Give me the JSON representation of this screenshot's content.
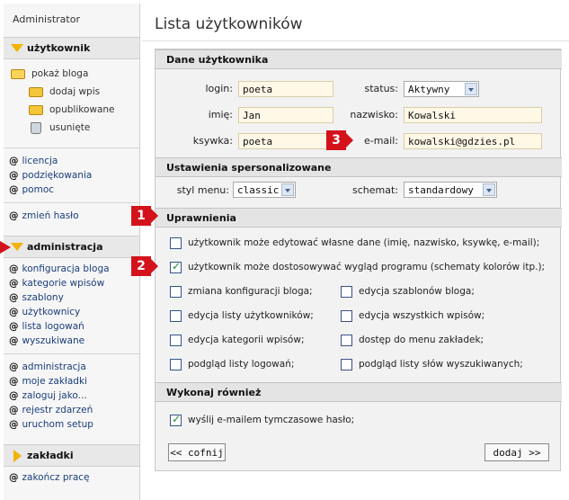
{
  "sidebar": {
    "user": "Administrator",
    "section_user": "użytkownik",
    "tree": [
      {
        "label": "pokaż bloga"
      },
      {
        "label": "dodaj wpis"
      },
      {
        "label": "opublikowane"
      },
      {
        "label": "usunięte"
      }
    ],
    "links_a": [
      "licencja",
      "podziękowania",
      "pomoc"
    ],
    "link_password": "zmień hasło",
    "section_admin": "administracja",
    "links_admin": [
      "konfiguracja bloga",
      "kategorie wpisów",
      "szablony",
      "użytkownicy",
      "lista logowań",
      "wyszukiwane"
    ],
    "links_admin2": [
      "administracja",
      "moje zakładki",
      "zaloguj jako...",
      "rejestr zdarzeń",
      "uruchom setup"
    ],
    "section_bookmarks": "zakładki",
    "link_logout": "zakończ pracę",
    "at": "@"
  },
  "main": {
    "title": "Lista użytkowników",
    "section_user_data": "Dane użytkownika",
    "fields": {
      "login_label": "login:",
      "login_value": "poeta",
      "status_label": "status:",
      "status_value": "Aktywny",
      "name_label": "imię:",
      "name_value": "Jan",
      "surname_label": "nazwisko:",
      "surname_value": "Kowalski",
      "nick_label": "ksywka:",
      "nick_value": "poeta",
      "email_label": "e-mail:",
      "email_value": "kowalski@gdzies.pl"
    },
    "section_personal": "Ustawienia spersonalizowane",
    "menu_style_label": "styl menu:",
    "menu_style_value": "classic",
    "scheme_label": "schemat:",
    "scheme_value": "standardowy",
    "section_perms": "Uprawnienia",
    "perm_wide": [
      {
        "label": "użytkownik może edytować własne dane (imię, nazwisko, ksywkę, e-mail);",
        "checked": false
      },
      {
        "label": "użytkownik może dostosowywać wygląd programu (schematy kolorów itp.);",
        "checked": true
      }
    ],
    "perm_grid": [
      {
        "left": "zmiana konfiguracji bloga;",
        "right": "edycja szablonów bloga;"
      },
      {
        "left": "edycja listy użytkowników;",
        "right": "edycja wszystkich wpisów;"
      },
      {
        "left": "edycja kategorii wpisów;",
        "right": "dostęp do menu zakładek;"
      },
      {
        "left": "podgląd listy logowań;",
        "right": "podgląd listy słów wyszukiwanych;"
      }
    ],
    "section_also": "Wykonaj również",
    "send_email_label": "wyślij e-mailem tymczasowe hasło;",
    "send_email_checked": true,
    "back_button": "<< cofnij",
    "add_button": "dodaj >>"
  },
  "callouts": {
    "one": "1",
    "two": "2",
    "three": "3"
  },
  "colors": {
    "callout": "#d4121b",
    "accent_triangle": "#f0b400",
    "input_bg": "#fff8e6"
  }
}
